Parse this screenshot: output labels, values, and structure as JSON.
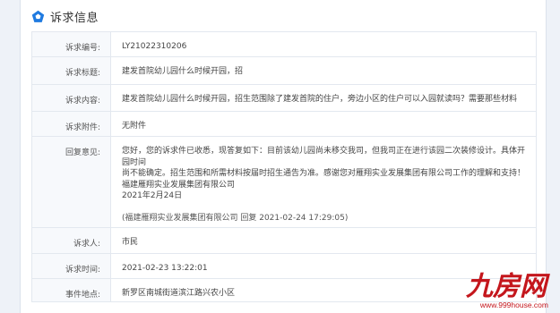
{
  "header": {
    "title": "诉求信息",
    "icon": "pentagon-icon",
    "accent": "#1f7ae0"
  },
  "fields": {
    "number": {
      "label": "诉求编号:",
      "value": "LY21022310206"
    },
    "subject": {
      "label": "诉求标题:",
      "value": "建发首院幼儿园什么时候开园，招"
    },
    "content": {
      "label": "诉求内容:",
      "value": "建发首院幼儿园什么时候开园，招生范围除了建发首院的住户，旁边小区的住户可以入园就读吗？需要那些材料"
    },
    "attachment": {
      "label": "诉求附件:",
      "value": "无附件"
    },
    "reply": {
      "label": "回复意见:",
      "lines": [
        "您好，您的诉求件已收悉，现答复如下：目前该幼儿园尚未移交我司，但我司正在进行该园二次装修设计。具体开园时间",
        "尚不能确定。招生范围和所需材料按届时招生通告为准。感谢您对雁翔实业发展集团有限公司工作的理解和支持！",
        "福建雁翔实业发展集团有限公司",
        "2021年2月24日"
      ],
      "signature": "(福建雁翔实业发展集团有限公司 回复 2021-02-24 17:29:05)"
    },
    "requester": {
      "label": "诉求人:",
      "value": "市民"
    },
    "time": {
      "label": "诉求时间:",
      "value": "2021-02-23 13:22:01"
    },
    "location": {
      "label": "事件地点:",
      "value": "新罗区南城街道滨江路兴农小区"
    }
  },
  "watermark": {
    "logo_text": "九房网",
    "url": "www.999house.com",
    "color": "#c4161c"
  }
}
